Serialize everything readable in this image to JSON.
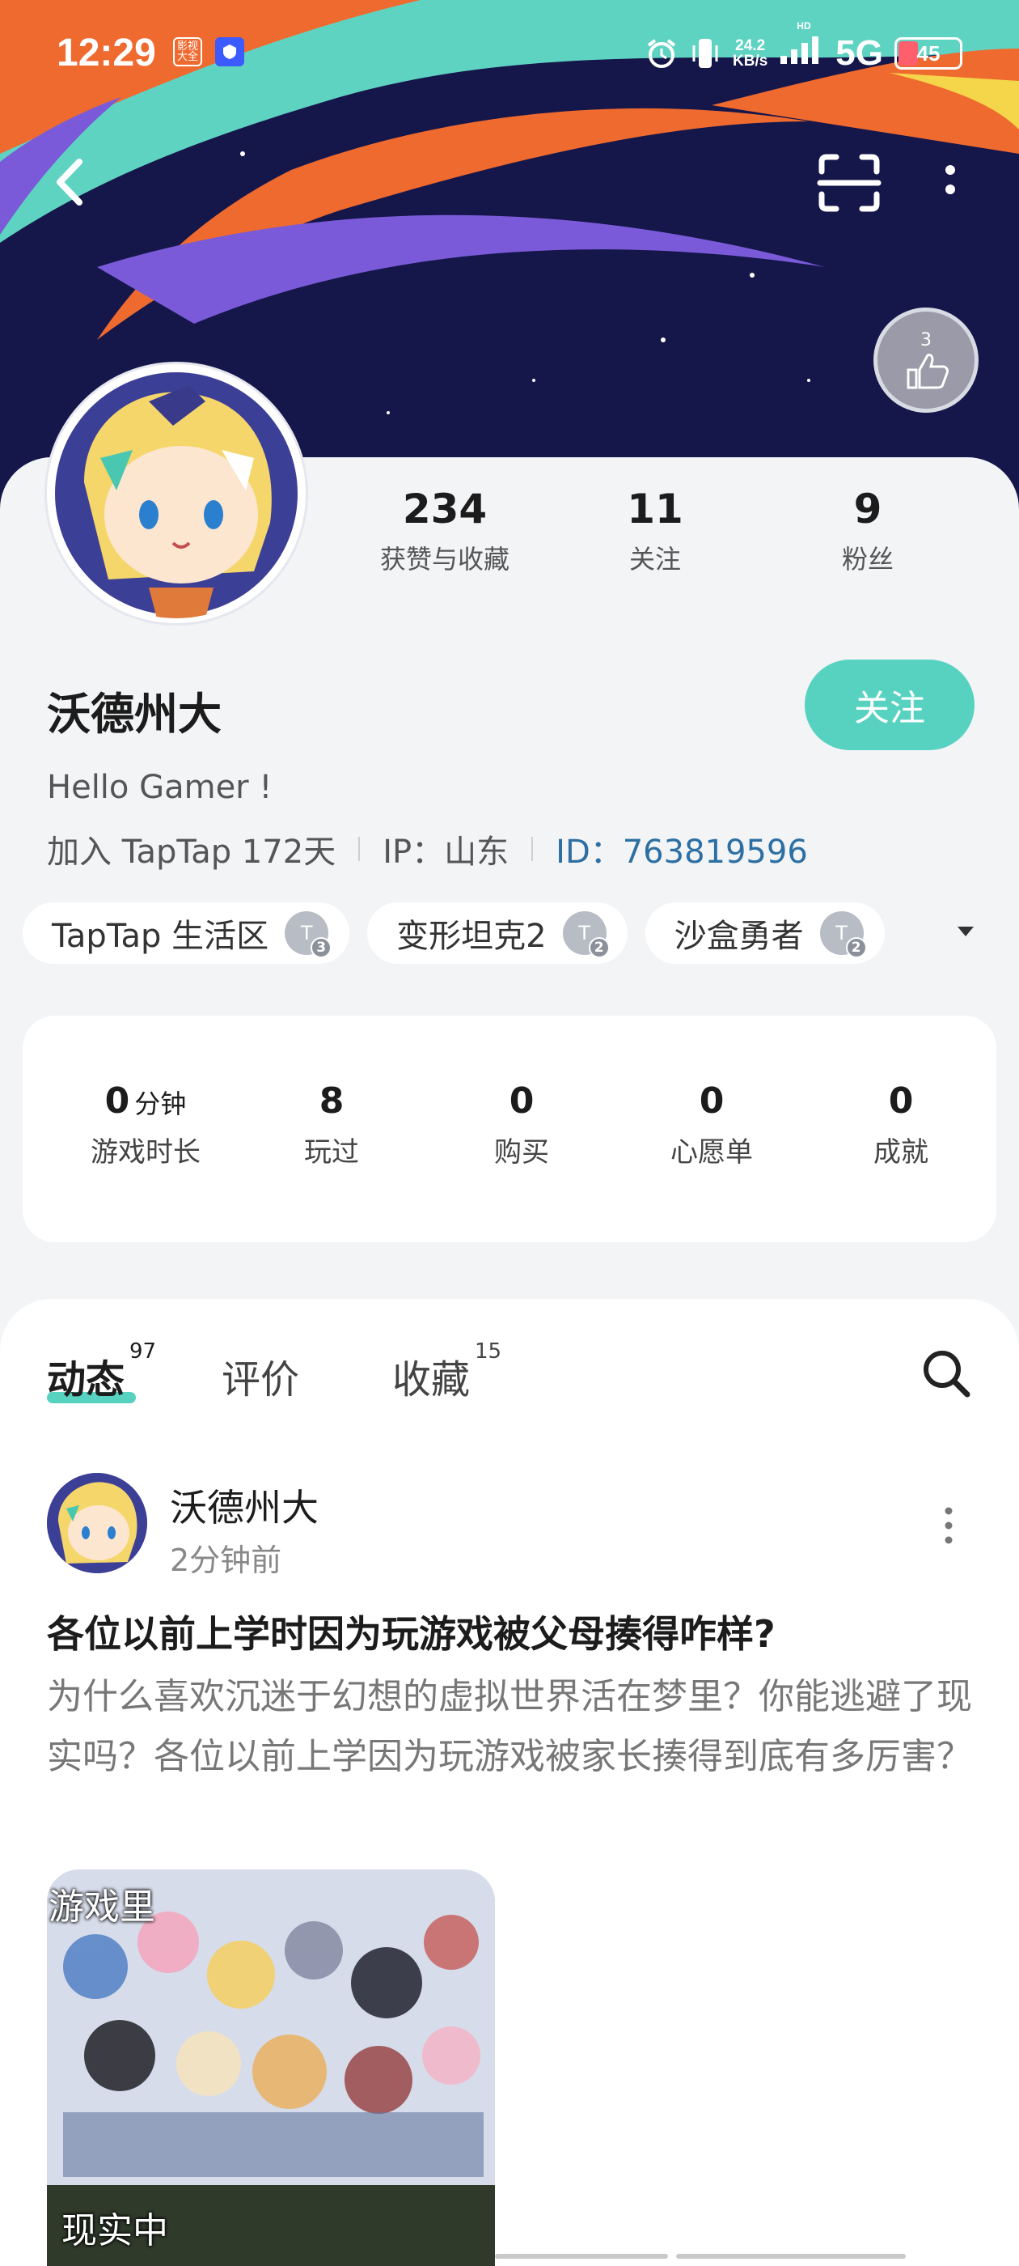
{
  "status_bar": {
    "time": "12:29",
    "badge_1": "影视\n大全",
    "net_speed_value": "24.2",
    "net_speed_unit": "KB/s",
    "hd_label": "HD",
    "network": "5G",
    "battery": "45"
  },
  "profile": {
    "stats": [
      {
        "value": "234",
        "label": "获赞与收藏"
      },
      {
        "value": "11",
        "label": "关注"
      },
      {
        "value": "9",
        "label": "粉丝"
      }
    ],
    "username": "沃德州大",
    "follow_label": "关注",
    "bio": "Hello Gamer !",
    "joined": "加入 TapTap 172天",
    "ip": "IP：山东",
    "id": "ID：763819596",
    "medal_text": "3",
    "tags": [
      {
        "name": "TapTap 生活区",
        "level": "3"
      },
      {
        "name": "变形坦克2",
        "level": "2"
      },
      {
        "name": "沙盒勇者",
        "level": "2"
      }
    ]
  },
  "game_stats": [
    {
      "value": "0",
      "unit": "分钟",
      "label": "游戏时长"
    },
    {
      "value": "8",
      "unit": "",
      "label": "玩过"
    },
    {
      "value": "0",
      "unit": "",
      "label": "购买"
    },
    {
      "value": "0",
      "unit": "",
      "label": "心愿单"
    },
    {
      "value": "0",
      "unit": "",
      "label": "成就"
    }
  ],
  "tabs": [
    {
      "label": "动态",
      "count": "97"
    },
    {
      "label": "评价",
      "count": ""
    },
    {
      "label": "收藏",
      "count": "15"
    }
  ],
  "post": {
    "author": "沃德州大",
    "time": "2分钟前",
    "title": "各位以前上学时因为玩游戏被父母揍得咋样?",
    "body": "为什么喜欢沉迷于幻想的虚拟世界活在梦里？你能逃避了现实吗？各位以前上学因为玩游戏被家长揍得到底有多厉害？",
    "image_top_caption": "游戏里",
    "image_bottom_caption": "现实中"
  },
  "colors": {
    "accent": "#58d2c0",
    "banner_bg": "#15164a",
    "id_link": "#2d6fa3"
  },
  "icons": {
    "back": "chevron-left-icon",
    "scan": "scan-icon",
    "more": "more-vertical-icon",
    "search": "search-icon"
  }
}
